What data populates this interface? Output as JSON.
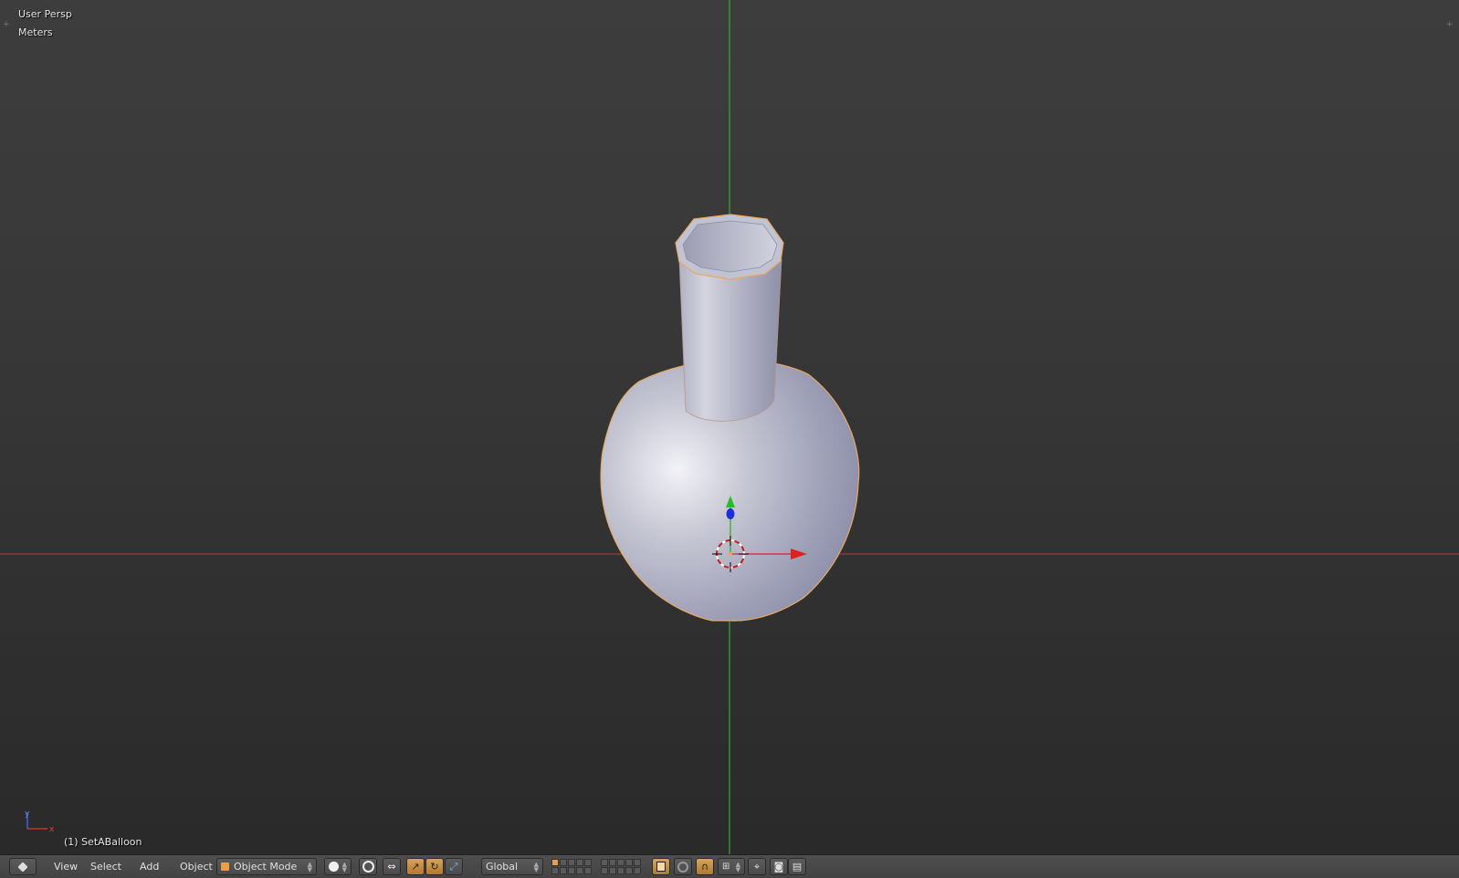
{
  "viewport": {
    "view_name": "User Persp",
    "units": "Meters",
    "object_label": "(1) SetABalloon",
    "mini_axes": {
      "x": "x",
      "y": "y"
    }
  },
  "header": {
    "editor_type_icon": "3d-view-editor-icon",
    "menus": [
      "View",
      "Select",
      "Add",
      "Object"
    ],
    "mode": "Object Mode",
    "mode_icon": "cube-icon",
    "shading_icon": "solid-sphere-icon",
    "orientation": "Global"
  },
  "colors": {
    "x_axis": "#c83232",
    "y_axis": "#32c832",
    "z_axis": "#3250ff",
    "selection_outline": "#f0a050",
    "accent": "#d89a48"
  }
}
